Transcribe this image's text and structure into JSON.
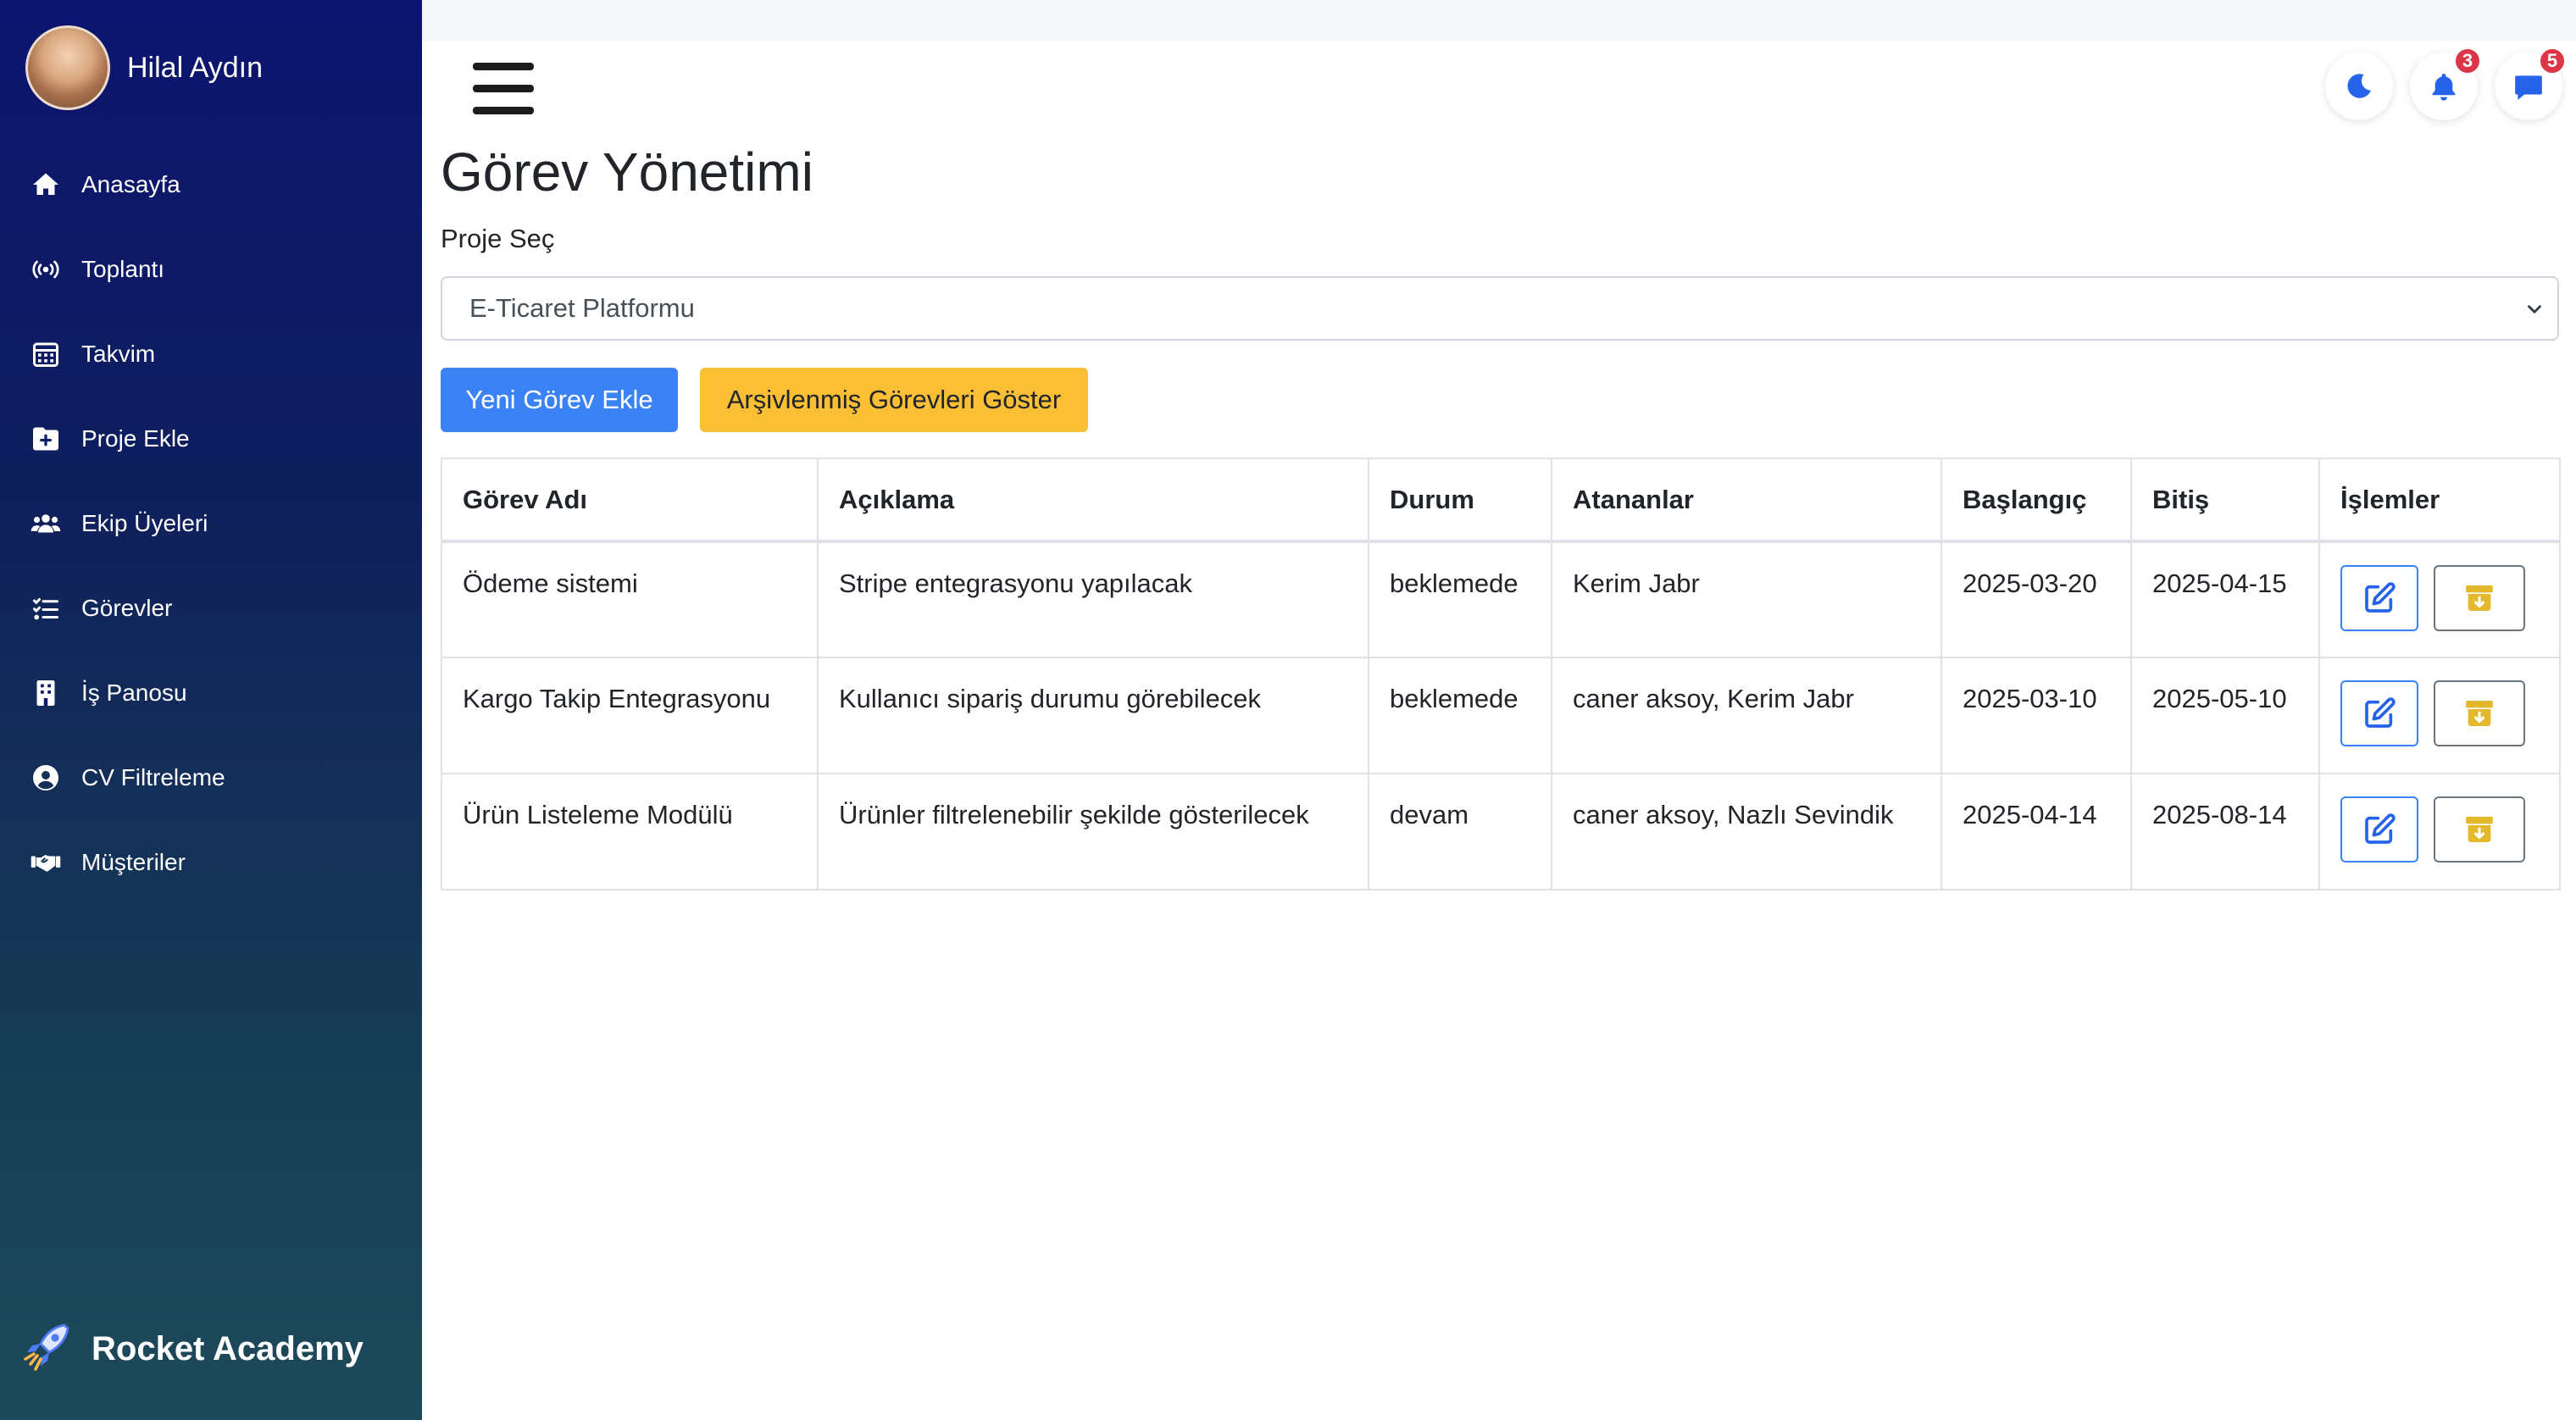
{
  "user": {
    "name": "Hilal Aydın"
  },
  "nav": [
    {
      "label": "Anasayfa",
      "icon": "home-icon"
    },
    {
      "label": "Toplantı",
      "icon": "broadcast-icon"
    },
    {
      "label": "Takvim",
      "icon": "calendar-icon"
    },
    {
      "label": "Proje Ekle",
      "icon": "folder-plus-icon"
    },
    {
      "label": "Ekip Üyeleri",
      "icon": "users-icon"
    },
    {
      "label": "Görevler",
      "icon": "list-check-icon"
    },
    {
      "label": "İş Panosu",
      "icon": "building-icon"
    },
    {
      "label": "CV Filtreleme",
      "icon": "user-circle-icon"
    },
    {
      "label": "Müşteriler",
      "icon": "handshake-icon"
    }
  ],
  "brand": {
    "name": "Rocket Academy",
    "icon": "rocket-icon"
  },
  "header": {
    "theme_icon": "moon-icon",
    "notifications": {
      "icon": "bell-icon",
      "count": "3"
    },
    "messages": {
      "icon": "chat-icon",
      "count": "5"
    }
  },
  "page": {
    "title": "Görev Yönetimi",
    "select_label": "Proje Seç",
    "selected_project": "E-Ticaret Platformu",
    "add_button": "Yeni Görev Ekle",
    "archive_button": "Arşivlenmiş Görevleri Göster"
  },
  "table": {
    "headers": [
      "Görev Adı",
      "Açıklama",
      "Durum",
      "Atananlar",
      "Başlangıç",
      "Bitiş",
      "İşlemler"
    ],
    "rows": [
      [
        "Ödeme sistemi",
        "Stripe entegrasyonu yapılacak",
        "beklemede",
        "Kerim Jabr",
        "2025-03-20",
        "2025-04-15"
      ],
      [
        "Kargo Takip Entegrasyonu",
        "Kullanıcı sipariş durumu görebilecek",
        "beklemede",
        "caner aksoy, Kerim Jabr",
        "2025-03-10",
        "2025-05-10"
      ],
      [
        "Ürün Listeleme Modülü",
        "Ürünler filtrelenebilir şekilde gösterilecek",
        "devam",
        "caner aksoy, Nazlı Sevindik",
        "2025-04-14",
        "2025-08-14"
      ]
    ],
    "action_icons": [
      "edit-icon",
      "archive-icon"
    ]
  },
  "colors": {
    "primary": "#3b82f6",
    "warning": "#fbbf36",
    "badge": "#dc3545",
    "sidebar_top": "#0d1470",
    "sidebar_bottom": "#1d4a5a"
  }
}
